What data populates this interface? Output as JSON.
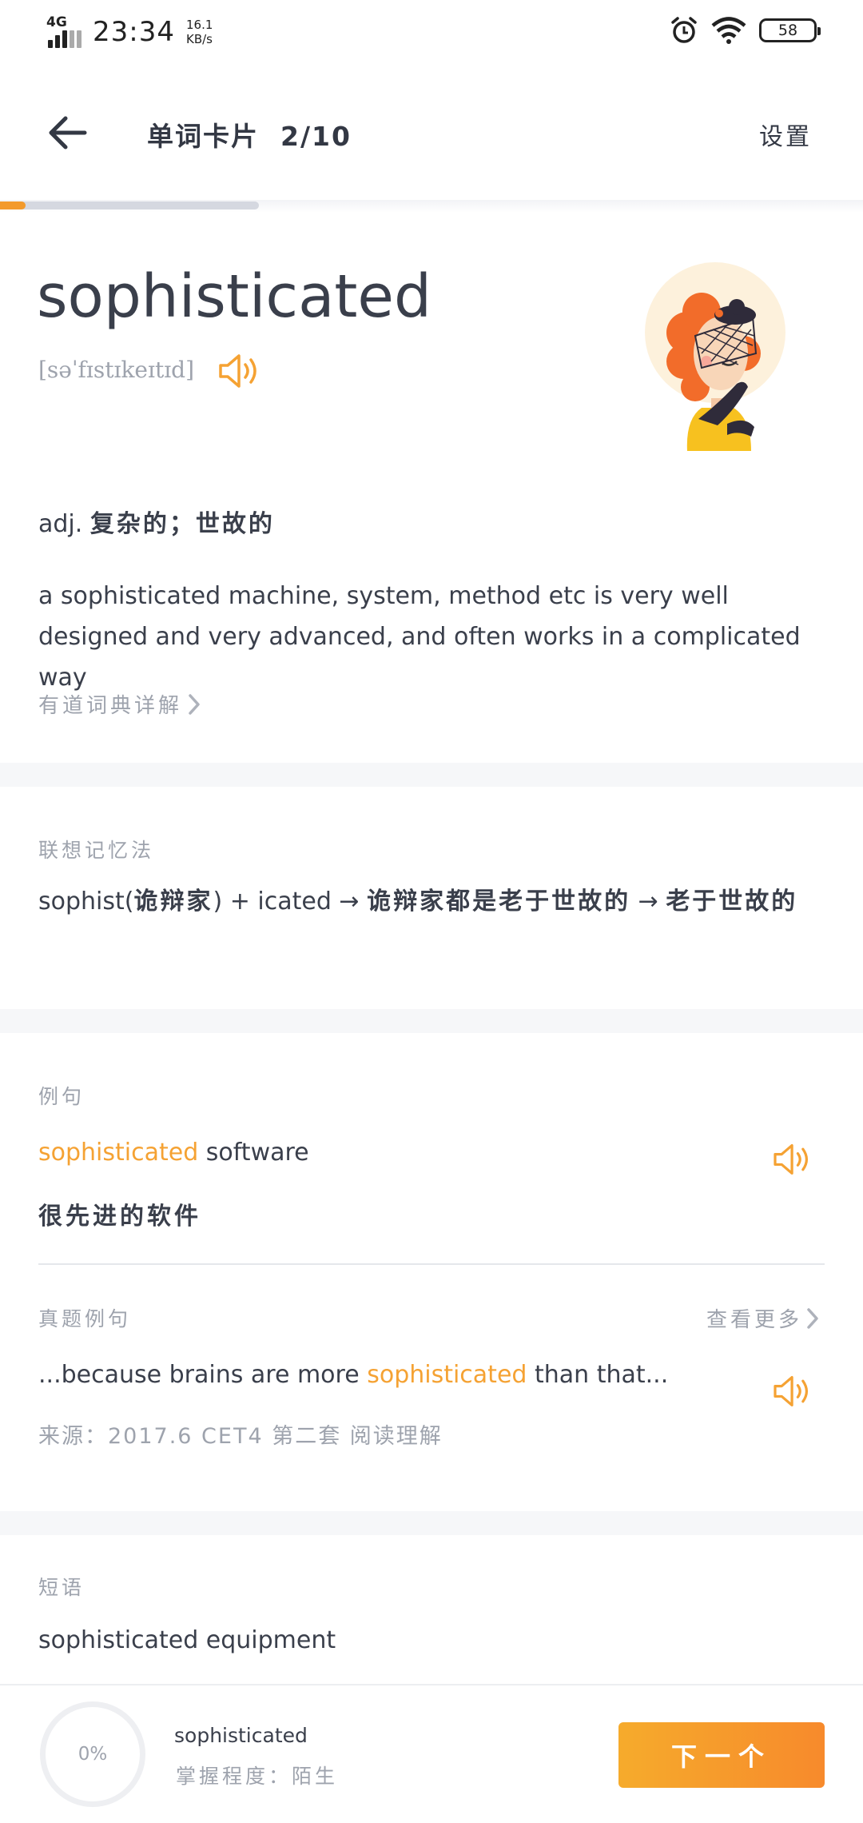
{
  "status_bar": {
    "network": "4G",
    "time": "23:34",
    "speed_value": "16.1",
    "speed_unit": "KB/s",
    "battery": "58",
    "icons": [
      "alarm-icon",
      "wifi-icon",
      "battery-icon"
    ]
  },
  "header": {
    "title": "单词卡片",
    "position": "2/10",
    "settings_label": "设置",
    "progress": 0.1
  },
  "word": {
    "text": "sophisticated",
    "phonetic": "[səˈfɪstɪkeɪtɪd]",
    "pos": "adj.",
    "meaning_cn": "复杂的；世故的",
    "definition_en": "a sophisticated machine, system, method etc is very well designed and very advanced, and often works in a complicated way",
    "dict_link": "有道词典详解"
  },
  "mnemonic": {
    "label": "联想记忆法",
    "part1": "sophist(",
    "part2": "诡辩家",
    "part3": ") + icated → ",
    "part4": "诡辩家都是老于世故的",
    "part5": " → ",
    "part6": "老于世故的"
  },
  "example": {
    "label": "例句",
    "highlight": "sophisticated",
    "rest": " software",
    "translation": "很先进的软件"
  },
  "exam_example": {
    "label": "真题例句",
    "more_label": "查看更多",
    "before": "...because brains are more ",
    "highlight": "sophisticated",
    "after": " than that...",
    "source": "来源：2017.6 CET4 第二套 阅读理解"
  },
  "phrases": {
    "label": "短语",
    "items": [
      "sophisticated equipment"
    ]
  },
  "bottom_bar": {
    "mastery_percent": "0%",
    "word": "sophisticated",
    "mastery_level": "掌握程度：陌生",
    "next_label": "下一个"
  },
  "colors": {
    "accent": "#f5a233",
    "text": "#3a3f4b",
    "muted": "#9ea3ad"
  }
}
